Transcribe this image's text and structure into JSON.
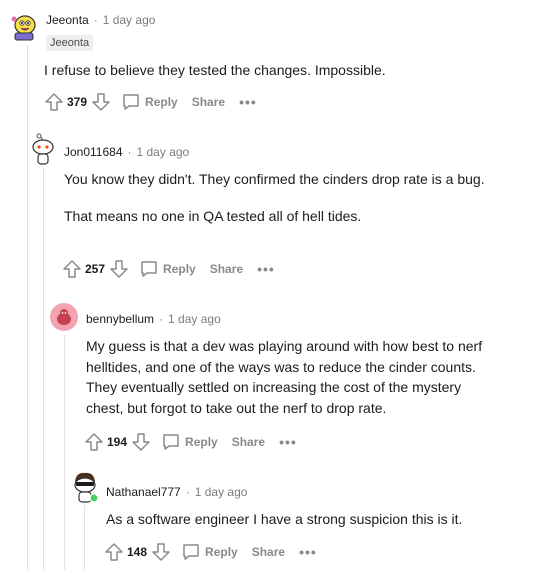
{
  "comments": [
    {
      "username": "Jeeonta",
      "time": "1 day ago",
      "flair": "Jeeonta",
      "paragraphs": [
        "I refuse to believe they tested the changes. Impossible."
      ],
      "score": "379",
      "reply_label": "Reply",
      "share_label": "Share",
      "more_label": "•••"
    },
    {
      "username": "Jon011684",
      "time": "1 day ago",
      "paragraphs": [
        "You know they didn't. They confirmed the cinders drop rate is a bug.",
        "That means no one in QA tested all of hell tides."
      ],
      "score": "257",
      "reply_label": "Reply",
      "share_label": "Share",
      "more_label": "•••"
    },
    {
      "username": "bennybellum",
      "time": "1 day ago",
      "paragraphs": [
        "My guess is that a dev was playing around with how best to nerf helltides, and one of the ways was to reduce the cinder counts. They eventually settled on increasing the cost of the mystery chest, but forgot to take out the nerf to drop rate."
      ],
      "score": "194",
      "reply_label": "Reply",
      "share_label": "Share",
      "more_label": "•••"
    },
    {
      "username": "Nathanael777",
      "time": "1 day ago",
      "paragraphs": [
        "As a software engineer I have a strong suspicion this is it."
      ],
      "score": "148",
      "reply_label": "Reply",
      "share_label": "Share",
      "more_label": "•••"
    }
  ],
  "separator": "·",
  "colors": {
    "meta": "#7c7c7c",
    "action": "#878a8c",
    "thread": "#e4e4e4",
    "flair_bg": "#edeff1"
  }
}
